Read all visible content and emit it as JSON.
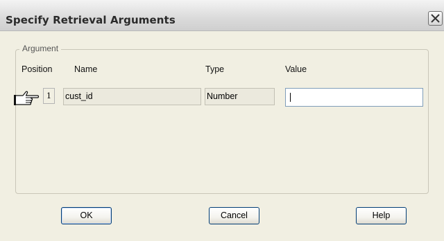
{
  "window": {
    "title": "Specify Retrieval Arguments"
  },
  "group": {
    "label": "Argument"
  },
  "headers": {
    "position": "Position",
    "name": "Name",
    "type": "Type",
    "value": "Value"
  },
  "rows": [
    {
      "position": "1",
      "name": "cust_id",
      "type": "Number",
      "value": ""
    }
  ],
  "buttons": {
    "ok": "OK",
    "cancel": "Cancel",
    "help": "Help"
  },
  "colors": {
    "dialog_bg": "#f1efe2",
    "input_border": "#7f9db9",
    "button_border": "#003c74"
  }
}
